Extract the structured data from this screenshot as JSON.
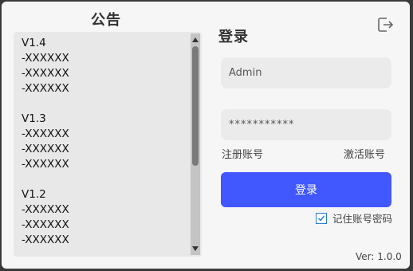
{
  "notice": {
    "title": "公告",
    "content": "V1.4\n-XXXXXX\n-XXXXXX\n-XXXXXX\n\nV1.3\n-XXXXXX\n-XXXXXX\n-XXXXXX\n\nV1.2\n-XXXXXX\n-XXXXXX\n-XXXXXX"
  },
  "login": {
    "title": "登录",
    "username_value": "Admin",
    "password_value": "***********",
    "register_link": "注册账号",
    "activate_link": "激活账号",
    "submit_label": "登录",
    "remember_label": "记住账号密码",
    "remember_checked": true
  },
  "footer": {
    "version": "Ver: 1.0.0"
  },
  "colors": {
    "accent": "#4157ff",
    "checkbox": "#2a7fd4"
  },
  "icons": {
    "exit": "exit-icon",
    "check": "check-icon"
  }
}
